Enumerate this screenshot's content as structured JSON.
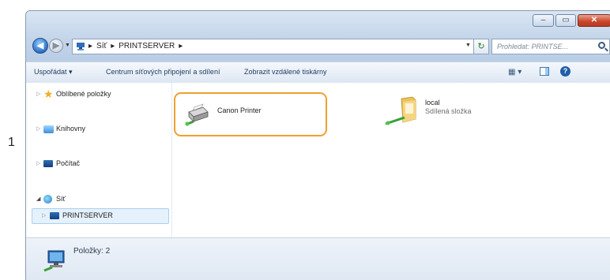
{
  "step_number": "1",
  "window": {
    "title_buttons": {
      "minimize": "–",
      "maximize": "▭",
      "close": "✕"
    }
  },
  "nav": {
    "back": "◀",
    "forward": "▶"
  },
  "address": {
    "segments": [
      "▸",
      "Síť",
      "▸",
      "PRINTSERVER",
      "▸"
    ]
  },
  "search": {
    "placeholder": "Prohledat: PRINTSE..."
  },
  "toolbar": {
    "organize": "Uspořádat ▾",
    "network_center": "Centrum síťových připojení a sdílení",
    "remote_printers": "Zobrazit vzdálené tiskárny",
    "help": "?"
  },
  "sidebar": {
    "items": [
      {
        "label": "Oblíbené položky",
        "icon": "star-icon"
      },
      {
        "label": "Knihovny",
        "icon": "libraries-icon"
      },
      {
        "label": "Počítač",
        "icon": "computer-icon"
      },
      {
        "label": "Síť",
        "icon": "network-icon"
      },
      {
        "label": "PRINTSERVER",
        "icon": "computer-icon"
      }
    ]
  },
  "content": {
    "items": [
      {
        "name": "Canon Printer",
        "subtitle": "",
        "icon": "printer-icon",
        "selected": true
      },
      {
        "name": "local",
        "subtitle": "Sdílená složka",
        "icon": "shared-folder-icon",
        "selected": false
      }
    ]
  },
  "status": {
    "text": "Položky: 2"
  },
  "colors": {
    "highlight": "#f0a030",
    "selection": "#e5f1fb"
  }
}
